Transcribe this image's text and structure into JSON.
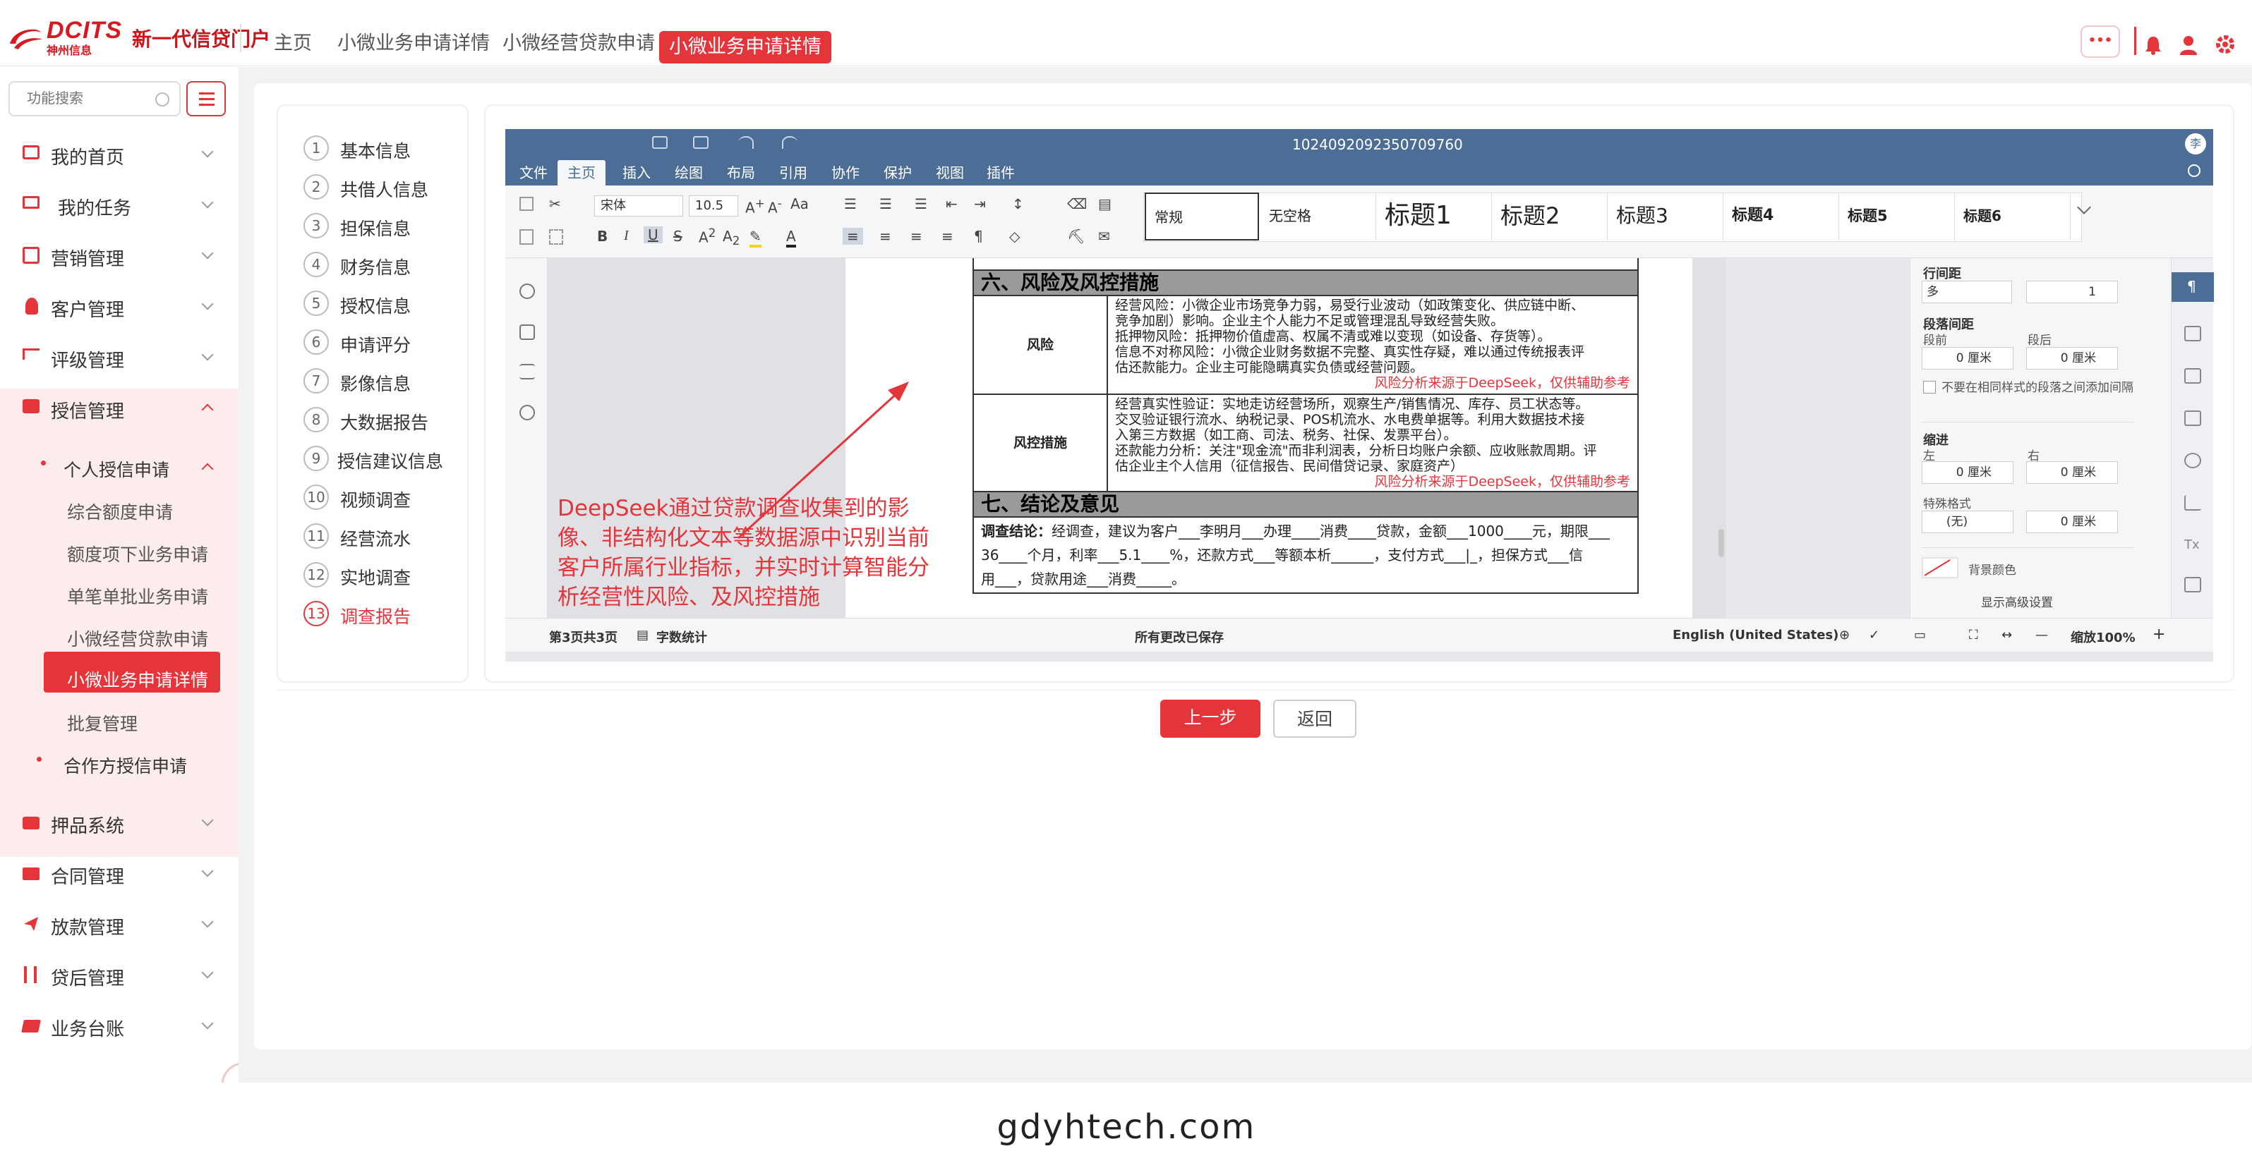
{
  "header": {
    "logo_brand": "DCITS",
    "logo_sub": "神州信息",
    "portal_title": "新一代信贷门户",
    "tabs": [
      {
        "label": "主页"
      },
      {
        "label": "小微业务申请详情"
      },
      {
        "label": "小微经营贷款申请"
      },
      {
        "label": "小微业务申请详情",
        "active": true
      }
    ],
    "more_label": "•••"
  },
  "sidebar": {
    "search_placeholder": "功能搜索",
    "menus": [
      {
        "label": "我的首页",
        "icon": "id-card-icon"
      },
      {
        "label": "我的任务",
        "icon": "monitor-icon"
      },
      {
        "label": "营销管理",
        "icon": "badge-icon"
      },
      {
        "label": "客户管理",
        "icon": "user-icon"
      },
      {
        "label": "评级管理",
        "icon": "flag-icon"
      },
      {
        "label": "授信管理",
        "icon": "id-card-icon",
        "expanded": true
      },
      {
        "label": "押品系统",
        "icon": "bag-icon"
      },
      {
        "label": "合同管理",
        "icon": "folder-icon"
      },
      {
        "label": "放款管理",
        "icon": "send-icon"
      },
      {
        "label": "贷后管理",
        "icon": "utensils-icon"
      },
      {
        "label": "业务台账",
        "icon": "folder-open-icon"
      }
    ],
    "sub_group": "个人授信申请",
    "sub_items": [
      "综合额度申请",
      "额度项下业务申请",
      "单笔单批业务申请",
      "小微经营贷款申请",
      "小微业务申请详情",
      "批复管理"
    ],
    "sub_group2": "合作方授信申请"
  },
  "steps": [
    {
      "n": "1",
      "label": "基本信息"
    },
    {
      "n": "2",
      "label": "共借人信息"
    },
    {
      "n": "3",
      "label": "担保信息"
    },
    {
      "n": "4",
      "label": "财务信息"
    },
    {
      "n": "5",
      "label": "授权信息"
    },
    {
      "n": "6",
      "label": "申请评分"
    },
    {
      "n": "7",
      "label": "影像信息"
    },
    {
      "n": "8",
      "label": "大数据报告"
    },
    {
      "n": "9",
      "label": "授信建议信息"
    },
    {
      "n": "10",
      "label": "视频调查"
    },
    {
      "n": "11",
      "label": "经营流水"
    },
    {
      "n": "12",
      "label": "实地调查"
    },
    {
      "n": "13",
      "label": "调查报告",
      "active": true
    }
  ],
  "editor": {
    "doc_id": "1024092092350709760",
    "user_initial": "李",
    "ribbon_tabs": [
      "文件",
      "主页",
      "插入",
      "绘图",
      "布局",
      "引用",
      "协作",
      "保护",
      "视图",
      "插件"
    ],
    "font_name": "宋体",
    "font_size": "10.5",
    "styles": [
      "常规",
      "无空格",
      "标题1",
      "标题2",
      "标题3",
      "标题4",
      "标题5",
      "标题6"
    ],
    "doc": {
      "sec6_title": "六、风险及风控措施",
      "risk_label": "风险",
      "risk_lines": [
        "经营风险：小微企业市场竞争力弱，易受行业波动（如政策变化、供应链中断、",
        "竞争加剧）影响。企业主个人能力不足或管理混乱导致经营失败。",
        "抵押物风险：抵押物价值虚高、权属不清或难以变现（如设备、存货等）。",
        "信息不对称风险：小微企业财务数据不完整、真实性存疑，难以通过传统报表评",
        "估还款能力。企业主可能隐瞒真实负债或经营问题。"
      ],
      "risk_note": "风险分析来源于DeepSeek，仅供辅助参考",
      "ctrl_label": "风控措施",
      "ctrl_lines": [
        "经营真实性验证：实地走访经营场所，观察生产/销售情况、库存、员工状态等。",
        "交叉验证银行流水、纳税记录、POS机流水、水电费单据等。利用大数据技术接",
        "入第三方数据（如工商、司法、税务、社保、发票平台）。",
        "还款能力分析：关注\"现金流\"而非利润表，分析日均账户余额、应收账款周期。评",
        "估企业主个人信用（征信报告、民间借贷记录、家庭资产）"
      ],
      "ctrl_note": "风险分析来源于DeepSeek，仅供辅助参考",
      "sec7_title": "七、结论及意见",
      "conclusion_label": "调查结论：",
      "conclusion_line1": "经调查，建议为客户___李明月___办理____消费____贷款，金额___1000____元，期限___",
      "conclusion_line2": "36____个月，利率___5.1____%，还款方式___等额本析______，支付方式___|_，担保方式___信",
      "conclusion_line3": "用___，贷款用途___消费_____。"
    },
    "annotation": "DeepSeek通过贷款调查收集到的影像、非结构化文本等数据源中识别当前客户所属行业指标，并实时计算智能分析经营性风险、及风控措施",
    "panel": {
      "line_spacing": "行间距",
      "line_spacing_mode": "多",
      "line_spacing_value": "1",
      "para_spacing": "段落间距",
      "before": "段前",
      "after": "段后",
      "before_value": "0 厘米",
      "after_value": "0 厘米",
      "no_space_same": "不要在相同样式的段落之间添加间隔",
      "indent": "缩进",
      "left": "左",
      "right": "右",
      "left_value": "0 厘米",
      "right_value": "0 厘米",
      "special": "特殊格式",
      "special_value": "(无)",
      "special_num": "0 厘米",
      "bg_color": "背景颜色",
      "advanced": "显示高级设置"
    },
    "status": {
      "page": "第3页共3页",
      "word_count": "字数统计",
      "saved": "所有更改已保存",
      "lang": "English (United States)",
      "zoom": "缩放100%"
    }
  },
  "actions": {
    "prev": "上一步",
    "back": "返回"
  },
  "watermark": "gdyhtech.com",
  "colors": {
    "brand": "#e3353a",
    "editor_header": "#4c6e96"
  }
}
